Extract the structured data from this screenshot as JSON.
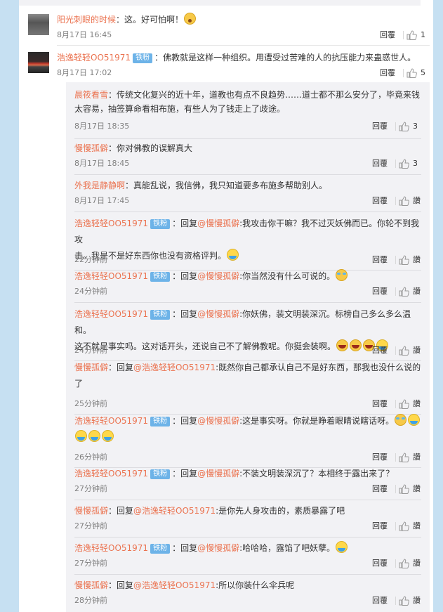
{
  "colors": {
    "accent": "#eb7350",
    "badge": "#6db3e8",
    "meta": "#808080"
  },
  "top_comments": [
    {
      "username": "阳光刺眼的时候",
      "text": "：这。好可怕啊！",
      "emoji": "shocked-emoji",
      "time": "8月17日 16:45",
      "reply_label": "回覆",
      "likes": "1"
    },
    {
      "username": "浩逸轻轻OO51971",
      "badge": "铁粉",
      "text": "：佛教就是这样一种组织。用遭受过苦难的人的抗压能力来蛊惑世人。",
      "time": "8月17日 17:02",
      "reply_label": "回覆",
      "likes": "5"
    }
  ],
  "replies": [
    {
      "username": "晨筱看雪",
      "text": "：传统文化复兴的近十年，道教也有点不良趋势……道士都不那么安分了，毕竟来钱",
      "text2": "太容易，抽签算命看相布施，有些人为了钱走上了歧途。",
      "time": "8月17日 18:35",
      "reply_label": "回覆",
      "likes": "3"
    },
    {
      "username": "慢慢孤僻",
      "text": "：你对佛教的误解真大",
      "time": "8月17日 18:45",
      "reply_label": "回覆",
      "likes": "3"
    },
    {
      "username": "外我是静静啊",
      "text": "：真能乱说，我信佛，我只知道要多布施多帮助别人。",
      "time": "8月17日 17:45",
      "reply_label": "回覆",
      "likes": "讚"
    },
    {
      "username": "浩逸轻轻OO51971",
      "badge": "铁粉",
      "prefix": "：回复",
      "mention": "@慢慢孤僻",
      "text": ":我攻击你干嘛？我不过灭妖佛而已。你轮不到我攻",
      "text2": "击。我是不是好东西你也没有资格评判。",
      "time": "22分钟前",
      "reply_label": "回覆",
      "likes": "讚"
    },
    {
      "username": "浩逸轻轻OO51971",
      "badge": "铁粉",
      "prefix": "：回复",
      "mention": "@慢慢孤僻",
      "text": ":你当然没有什么可说的。",
      "time": "24分钟前",
      "reply_label": "回覆",
      "likes": "讚"
    },
    {
      "username": "浩逸轻轻OO51971",
      "badge": "铁粉",
      "prefix": "：回复",
      "mention": "@慢慢孤僻",
      "text": ":你妖佛，装文明装深沉。标榜自己多么多么温和。",
      "text2": "这不就是事实吗。这对话开头，还说自己不了解佛教呢。你挺会装啊。",
      "time": "24分钟前",
      "reply_label": "回覆",
      "likes": "讚"
    },
    {
      "username": "慢慢孤僻",
      "prefix": "：回复",
      "mention": "@浩逸轻轻OO51971",
      "text": ":既然你自己都承认自己不是好东西，那我也没什么说的",
      "text2": "了",
      "time": "25分钟前",
      "reply_label": "回覆",
      "likes": "讚"
    },
    {
      "username": "浩逸轻轻OO51971",
      "badge": "铁粉",
      "prefix": "：回复",
      "mention": "@慢慢孤僻",
      "text": ":这是事实呀。你就是睁着眼睛说瞎话呀。",
      "time": "26分钟前",
      "reply_label": "回覆",
      "likes": "讚"
    },
    {
      "username": "浩逸轻轻OO51971",
      "badge": "铁粉",
      "prefix": "：回复",
      "mention": "@慢慢孤僻",
      "text": ":不装文明装深沉了？本相终于露出来了？",
      "time": "27分钟前",
      "reply_label": "回覆",
      "likes": "讚"
    },
    {
      "username": "慢慢孤僻",
      "prefix": "：回复",
      "mention": "@浩逸轻轻OO51971",
      "text": ":是你先人身攻击的，素质暴露了吧",
      "time": "27分钟前",
      "reply_label": "回覆",
      "likes": "讚"
    },
    {
      "username": "浩逸轻轻OO51971",
      "badge": "铁粉",
      "prefix": "：回复",
      "mention": "@慢慢孤僻",
      "text": ":哈哈哈，露馅了吧妖孽。",
      "time": "27分钟前",
      "reply_label": "回覆",
      "likes": "讚"
    },
    {
      "username": "慢慢孤僻",
      "prefix": "：回复",
      "mention": "@浩逸轻轻OO51971",
      "text": ":所以你装什么伞兵呢",
      "time": "28分钟前",
      "reply_label": "回覆",
      "likes": "讚"
    }
  ]
}
